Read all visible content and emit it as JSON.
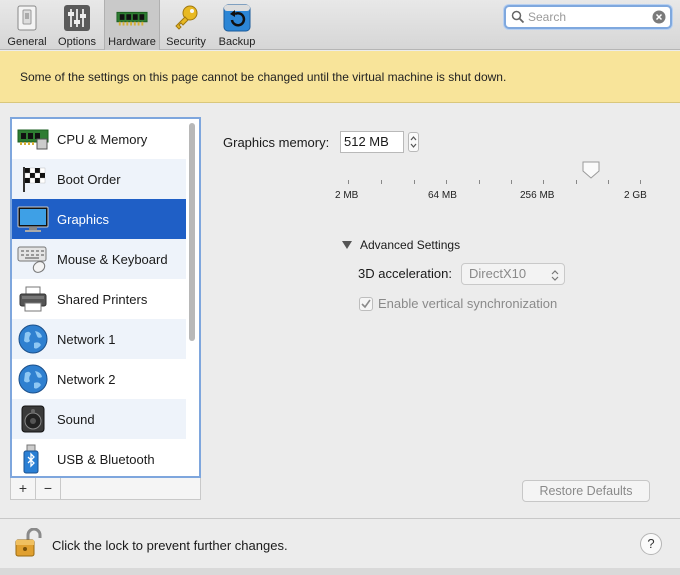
{
  "toolbar": {
    "items": [
      {
        "label": "General",
        "icon": "general-icon"
      },
      {
        "label": "Options",
        "icon": "options-sliders-icon"
      },
      {
        "label": "Hardware",
        "icon": "hardware-chip-icon",
        "active": true
      },
      {
        "label": "Security",
        "icon": "key-icon"
      },
      {
        "label": "Backup",
        "icon": "backup-icon"
      }
    ]
  },
  "search": {
    "placeholder": "Search",
    "value": ""
  },
  "banner": {
    "text": "Some of the settings on this page cannot be changed until the virtual machine is shut down."
  },
  "sidebar": {
    "items": [
      {
        "label": "CPU & Memory",
        "icon": "cpu-memory-icon"
      },
      {
        "label": "Boot Order",
        "icon": "boot-order-flag-icon"
      },
      {
        "label": "Graphics",
        "icon": "monitor-icon",
        "selected": true
      },
      {
        "label": "Mouse & Keyboard",
        "icon": "keyboard-mouse-icon"
      },
      {
        "label": "Shared Printers",
        "icon": "printer-icon"
      },
      {
        "label": "Network 1",
        "icon": "globe-icon"
      },
      {
        "label": "Network 2",
        "icon": "globe-icon"
      },
      {
        "label": "Sound",
        "icon": "speaker-icon"
      },
      {
        "label": "USB & Bluetooth",
        "icon": "usb-bluetooth-icon"
      }
    ],
    "add_label": "+",
    "remove_label": "−"
  },
  "graphics": {
    "memory_label": "Graphics memory:",
    "memory_value": "512 MB",
    "slider_ticks": [
      "2 MB",
      "64 MB",
      "256 MB",
      "2 GB"
    ],
    "slider_position_fraction": 0.82,
    "advanced_label": "Advanced Settings",
    "acceleration_label": "3D acceleration:",
    "acceleration_value": "DirectX10",
    "vsync_label": "Enable vertical synchronization",
    "vsync_checked": true
  },
  "buttons": {
    "restore_defaults": "Restore Defaults"
  },
  "footer": {
    "lock_text": "Click the lock to prevent further changes.",
    "help_label": "?"
  }
}
